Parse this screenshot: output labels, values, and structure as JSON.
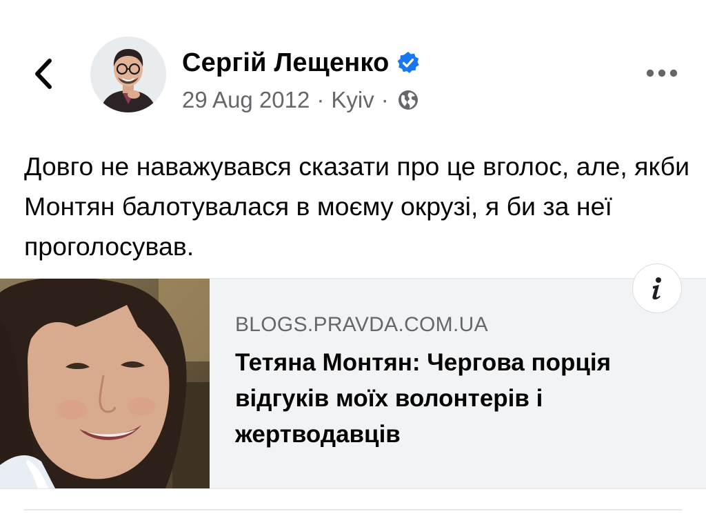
{
  "header": {
    "back_icon": "chevron-left-icon",
    "author_name": "Сергій Лещенко",
    "verified_icon": "verified-badge-icon",
    "verified_color": "#1877f2",
    "date": "29 Aug 2012",
    "separator": "·",
    "location": "Kyiv",
    "audience_icon": "globe-icon",
    "more_icon": "more-dots-icon"
  },
  "post": {
    "text": "Довго не наважувався сказати про це вголос, але, якби Монтян балотувалася в моєму окрузі, я би за неї проголосував."
  },
  "link_preview": {
    "domain": "BLOGS.PRAVDA.COM.UA",
    "title": "Тетяна Монтян: Чергова порція відгуків моїх волонтерів і жертводавців",
    "info_icon": "info-icon",
    "image": "woman-portrait-photo"
  },
  "colors": {
    "text": "#050505",
    "secondary_text": "#65676b",
    "card_background": "#f2f3f5",
    "accent": "#1877f2"
  }
}
